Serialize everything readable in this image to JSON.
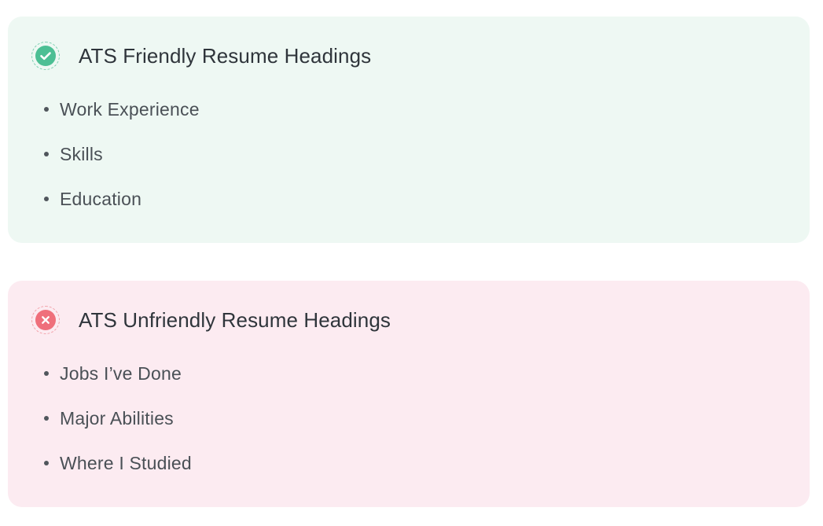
{
  "friendly": {
    "icon": "check-circle-icon",
    "accent_color": "#4cbf94",
    "background_color": "#eef8f3",
    "title": "ATS Friendly Resume Headings",
    "items": [
      {
        "label": "Work Experience"
      },
      {
        "label": "Skills"
      },
      {
        "label": "Education"
      }
    ]
  },
  "unfriendly": {
    "icon": "x-circle-icon",
    "accent_color": "#ef6f7b",
    "background_color": "#fcebf1",
    "title": "ATS Unfriendly Resume Headings",
    "items": [
      {
        "label": "Jobs I’ve Done"
      },
      {
        "label": "Major Abilities"
      },
      {
        "label": "Where I Studied"
      }
    ]
  }
}
